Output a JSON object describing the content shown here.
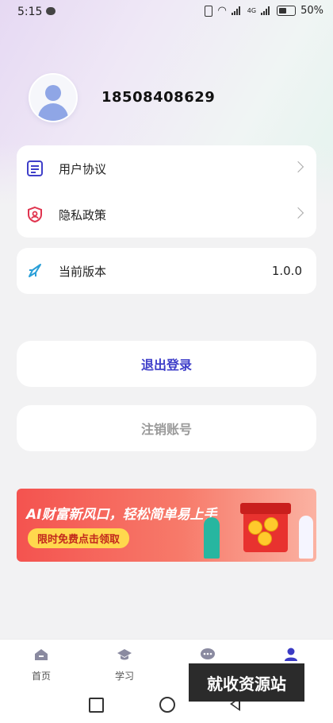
{
  "status_bar": {
    "time": "5:15",
    "network": "4G",
    "battery": "50%"
  },
  "profile": {
    "phone": "18508408629"
  },
  "menu_card": {
    "items": [
      {
        "label": "用户协议",
        "icon": "document-icon"
      },
      {
        "label": "隐私政策",
        "icon": "privacy-shield-icon"
      }
    ]
  },
  "version_card": {
    "label": "当前版本",
    "value": "1.0.0",
    "icon": "rocket-icon"
  },
  "buttons": {
    "logout": "退出登录",
    "deregister": "注销账号"
  },
  "banner": {
    "headline": "AI财富新风口，轻松简单易上手",
    "cta": "限时免费点击领取"
  },
  "bottom_nav": {
    "items": [
      {
        "label": "首页",
        "icon": "home-icon"
      },
      {
        "label": "学习",
        "icon": "graduation-cap-icon"
      },
      {
        "label": "",
        "icon": "chat-icon"
      },
      {
        "label": "",
        "icon": "user-icon"
      }
    ]
  },
  "watermark": "就收资源站",
  "colors": {
    "accent": "#3f3fc9",
    "muted": "#9a9a9a",
    "nav_active": "#3a3ac4"
  }
}
